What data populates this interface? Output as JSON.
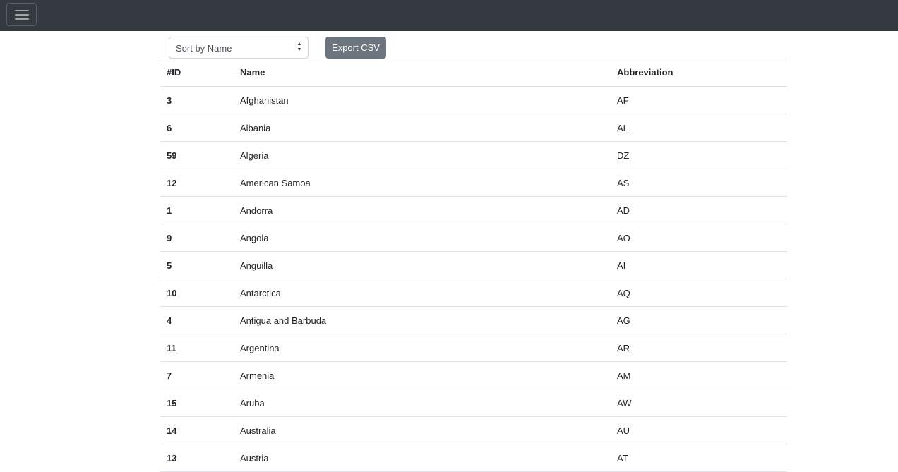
{
  "navbar": {
    "toggler_icon": "hamburger-icon"
  },
  "controls": {
    "sort_select_value": "Sort by Name",
    "sort_caret_icon": "up-down-caret-icon",
    "export_label": "Export CSV"
  },
  "table": {
    "headers": [
      "#ID",
      "Name",
      "Abbreviation"
    ],
    "rows": [
      {
        "id": "3",
        "name": "Afghanistan",
        "abbr": "AF"
      },
      {
        "id": "6",
        "name": "Albania",
        "abbr": "AL"
      },
      {
        "id": "59",
        "name": "Algeria",
        "abbr": "DZ"
      },
      {
        "id": "12",
        "name": "American Samoa",
        "abbr": "AS"
      },
      {
        "id": "1",
        "name": "Andorra",
        "abbr": "AD"
      },
      {
        "id": "9",
        "name": "Angola",
        "abbr": "AO"
      },
      {
        "id": "5",
        "name": "Anguilla",
        "abbr": "AI"
      },
      {
        "id": "10",
        "name": "Antarctica",
        "abbr": "AQ"
      },
      {
        "id": "4",
        "name": "Antigua and Barbuda",
        "abbr": "AG"
      },
      {
        "id": "11",
        "name": "Argentina",
        "abbr": "AR"
      },
      {
        "id": "7",
        "name": "Armenia",
        "abbr": "AM"
      },
      {
        "id": "15",
        "name": "Aruba",
        "abbr": "AW"
      },
      {
        "id": "14",
        "name": "Australia",
        "abbr": "AU"
      },
      {
        "id": "13",
        "name": "Austria",
        "abbr": "AT"
      }
    ]
  }
}
